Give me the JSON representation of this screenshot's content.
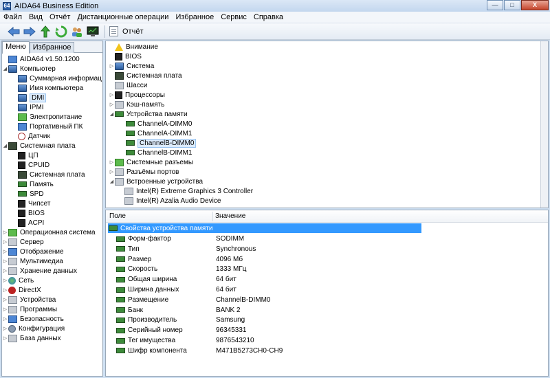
{
  "window": {
    "title": "AIDA64 Business Edition",
    "minimize": "—",
    "maximize": "□",
    "close": "X"
  },
  "menu": [
    "Файл",
    "Вид",
    "Отчёт",
    "Дистанционные операции",
    "Избранное",
    "Сервис",
    "Справка"
  ],
  "toolbar": {
    "report_label": "Отчёт"
  },
  "left_tabs": [
    "Меню",
    "Избранное"
  ],
  "left_tree": [
    {
      "label": "AIDA64 v1.50.1200",
      "icon": "app-icon"
    },
    {
      "label": "Компьютер",
      "icon": "computer-icon"
    },
    {
      "label": "Суммарная информац",
      "icon": "computer-icon"
    },
    {
      "label": "Имя компьютера",
      "icon": "computer-icon"
    },
    {
      "label": "DMI",
      "icon": "computer-icon"
    },
    {
      "label": "IPMI",
      "icon": "computer-icon"
    },
    {
      "label": "Электропитание",
      "icon": "power-icon"
    },
    {
      "label": "Портативный ПК",
      "icon": "laptop-icon"
    },
    {
      "label": "Датчик",
      "icon": "sensor-icon"
    },
    {
      "label": "Системная плата",
      "icon": "motherboard-icon"
    },
    {
      "label": "ЦП",
      "icon": "cpu-icon"
    },
    {
      "label": "CPUID",
      "icon": "cpu-icon"
    },
    {
      "label": "Системная плата",
      "icon": "motherboard-icon"
    },
    {
      "label": "Память",
      "icon": "memory-icon"
    },
    {
      "label": "SPD",
      "icon": "memory-icon"
    },
    {
      "label": "Чипсет",
      "icon": "chip-icon"
    },
    {
      "label": "BIOS",
      "icon": "chip-icon"
    },
    {
      "label": "ACPI",
      "icon": "chip-icon"
    },
    {
      "label": "Операционная система",
      "icon": "windows-icon"
    },
    {
      "label": "Сервер",
      "icon": "server-icon"
    },
    {
      "label": "Отображение",
      "icon": "display-icon"
    },
    {
      "label": "Мультимедиа",
      "icon": "multimedia-icon"
    },
    {
      "label": "Хранение данных",
      "icon": "storage-icon"
    },
    {
      "label": "Сеть",
      "icon": "network-icon"
    },
    {
      "label": "DirectX",
      "icon": "directx-icon"
    },
    {
      "label": "Устройства",
      "icon": "devices-icon"
    },
    {
      "label": "Программы",
      "icon": "programs-icon"
    },
    {
      "label": "Безопасность",
      "icon": "security-icon"
    },
    {
      "label": "Конфигурация",
      "icon": "config-icon"
    },
    {
      "label": "База данных",
      "icon": "database-icon"
    }
  ],
  "dmi_tree": [
    {
      "label": "Внимание",
      "icon": "warning-icon"
    },
    {
      "label": "BIOS",
      "icon": "chip-icon"
    },
    {
      "label": "Система",
      "icon": "computer-icon"
    },
    {
      "label": "Системная плата",
      "icon": "motherboard-icon"
    },
    {
      "label": "Шасси",
      "icon": "chassis-icon"
    },
    {
      "label": "Процессоры",
      "icon": "cpu-icon"
    },
    {
      "label": "Кэш-память",
      "icon": "cache-icon"
    },
    {
      "label": "Устройства памяти",
      "icon": "memory-icon"
    },
    {
      "label": "ChannelA-DIMM0",
      "icon": "memory-icon"
    },
    {
      "label": "ChannelA-DIMM1",
      "icon": "memory-icon"
    },
    {
      "label": "ChannelB-DIMM0",
      "icon": "memory-icon"
    },
    {
      "label": "ChannelB-DIMM1",
      "icon": "memory-icon"
    },
    {
      "label": "Системные разъемы",
      "icon": "slot-icon"
    },
    {
      "label": "Разъёмы портов",
      "icon": "port-icon"
    },
    {
      "label": "Встроенные устройства",
      "icon": "onboard-icon"
    },
    {
      "label": "Intel(R) Extreme Graphics 3 Controller",
      "icon": "onboard-icon"
    },
    {
      "label": "Intel(R) Azalia Audio Device",
      "icon": "onboard-icon"
    }
  ],
  "details": {
    "col_field": "Поле",
    "col_value": "Значение",
    "section": "Свойства устройства памяти",
    "rows": [
      {
        "field": "Форм-фактор",
        "value": "SODIMM"
      },
      {
        "field": "Тип",
        "value": "Synchronous"
      },
      {
        "field": "Размер",
        "value": "4096 Мб"
      },
      {
        "field": "Скорость",
        "value": "1333 МГц"
      },
      {
        "field": "Общая ширина",
        "value": "64 бит"
      },
      {
        "field": "Ширина данных",
        "value": "64 бит"
      },
      {
        "field": "Размещение",
        "value": "ChannelB-DIMM0"
      },
      {
        "field": "Банк",
        "value": "BANK 2"
      },
      {
        "field": "Производитель",
        "value": "Samsung"
      },
      {
        "field": "Серийный номер",
        "value": "96345331"
      },
      {
        "field": "Тег имущества",
        "value": "9876543210"
      },
      {
        "field": "Шифр компонента",
        "value": "M471B5273CH0-CH9"
      }
    ]
  }
}
